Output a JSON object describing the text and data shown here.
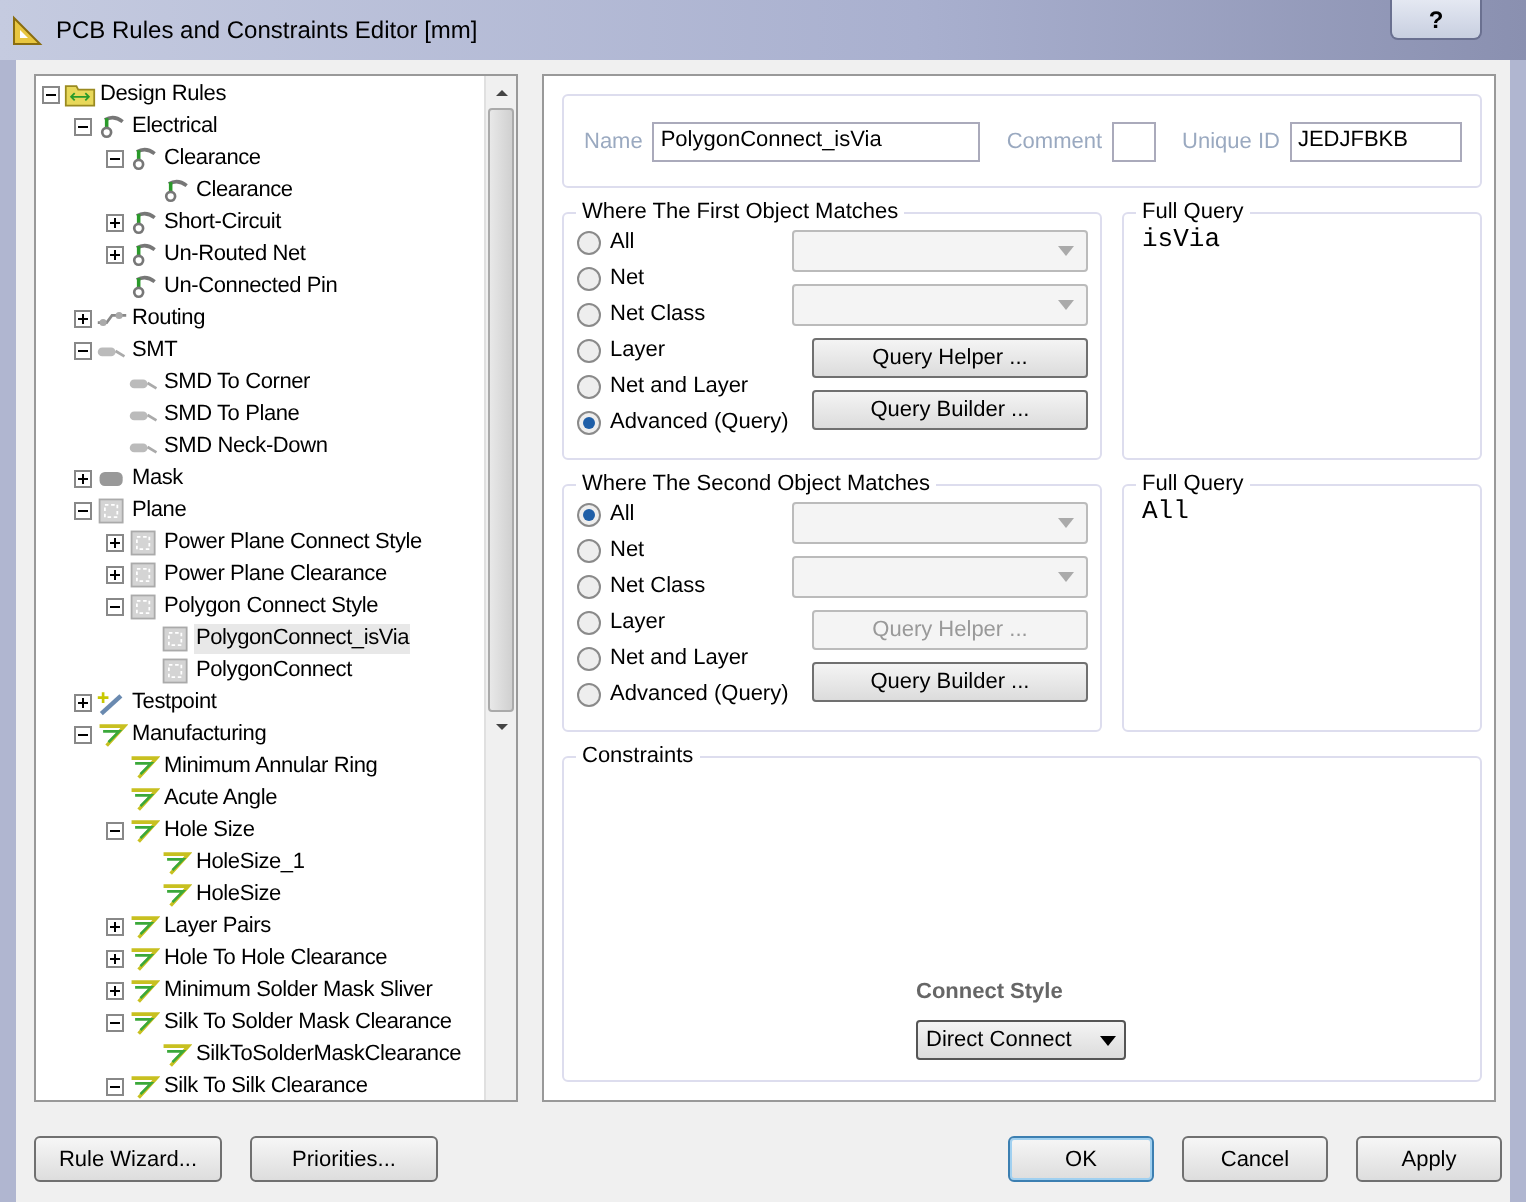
{
  "window": {
    "title": "PCB Rules and Constraints Editor [mm]",
    "help_button": "?"
  },
  "tree": [
    {
      "label": "Design Rules",
      "kind": "root",
      "expanded": true,
      "selected": false,
      "children": [
        {
          "label": "Electrical",
          "kind": "electrical",
          "expanded": true,
          "selected": false,
          "children": [
            {
              "label": "Clearance",
              "kind": "electrical",
              "expanded": true,
              "selected": false,
              "children": [
                {
                  "label": "Clearance",
                  "kind": "electrical",
                  "selected": false
                }
              ]
            },
            {
              "label": "Short-Circuit",
              "kind": "electrical",
              "expanded": false,
              "selected": false
            },
            {
              "label": "Un-Routed Net",
              "kind": "electrical",
              "expanded": false,
              "selected": false
            },
            {
              "label": "Un-Connected Pin",
              "kind": "electrical",
              "selected": false
            }
          ]
        },
        {
          "label": "Routing",
          "kind": "routing",
          "expanded": false,
          "selected": false
        },
        {
          "label": "SMT",
          "kind": "smt",
          "expanded": true,
          "selected": false,
          "children": [
            {
              "label": "SMD To Corner",
              "kind": "smt",
              "selected": false
            },
            {
              "label": "SMD To Plane",
              "kind": "smt",
              "selected": false
            },
            {
              "label": "SMD Neck-Down",
              "kind": "smt",
              "selected": false
            }
          ]
        },
        {
          "label": "Mask",
          "kind": "mask",
          "expanded": false,
          "selected": false
        },
        {
          "label": "Plane",
          "kind": "plane",
          "expanded": true,
          "selected": false,
          "children": [
            {
              "label": "Power Plane Connect Style",
              "kind": "plane",
              "expanded": false,
              "selected": false
            },
            {
              "label": "Power Plane Clearance",
              "kind": "plane",
              "expanded": false,
              "selected": false
            },
            {
              "label": "Polygon Connect Style",
              "kind": "plane",
              "expanded": true,
              "selected": false,
              "children": [
                {
                  "label": "PolygonConnect_isVia",
                  "kind": "plane",
                  "selected": true
                },
                {
                  "label": "PolygonConnect",
                  "kind": "plane",
                  "selected": false
                }
              ]
            }
          ]
        },
        {
          "label": "Testpoint",
          "kind": "testpoint",
          "expanded": false,
          "selected": false
        },
        {
          "label": "Manufacturing",
          "kind": "manufacturing",
          "expanded": true,
          "selected": false,
          "children": [
            {
              "label": "Minimum Annular Ring",
              "kind": "manufacturing",
              "selected": false
            },
            {
              "label": "Acute Angle",
              "kind": "manufacturing",
              "selected": false
            },
            {
              "label": "Hole Size",
              "kind": "manufacturing",
              "expanded": true,
              "selected": false,
              "children": [
                {
                  "label": "HoleSize_1",
                  "kind": "manufacturing",
                  "selected": false
                },
                {
                  "label": "HoleSize",
                  "kind": "manufacturing",
                  "selected": false
                }
              ]
            },
            {
              "label": "Layer Pairs",
              "kind": "manufacturing",
              "expanded": false,
              "selected": false
            },
            {
              "label": "Hole To Hole Clearance",
              "kind": "manufacturing",
              "expanded": false,
              "selected": false
            },
            {
              "label": "Minimum Solder Mask Sliver",
              "kind": "manufacturing",
              "expanded": false,
              "selected": false
            },
            {
              "label": "Silk To Solder Mask Clearance",
              "kind": "manufacturing",
              "expanded": true,
              "selected": false,
              "children": [
                {
                  "label": "SilkToSolderMaskClearance",
                  "kind": "manufacturing",
                  "selected": false
                }
              ]
            },
            {
              "label": "Silk To Silk Clearance",
              "kind": "manufacturing",
              "expanded": true,
              "selected": false
            }
          ]
        }
      ]
    }
  ],
  "rule": {
    "name_label": "Name",
    "name": "PolygonConnect_isVia",
    "comment_label": "Comment",
    "unique_id_label": "Unique ID",
    "unique_id": "JEDJFBKB"
  },
  "matches": [
    {
      "title": "Where The First Object Matches",
      "options": [
        {
          "label": "All",
          "selected": false
        },
        {
          "label": "Net",
          "selected": false
        },
        {
          "label": "Net Class",
          "selected": false
        },
        {
          "label": "Layer",
          "selected": false
        },
        {
          "label": "Net and Layer",
          "selected": false
        },
        {
          "label": "Advanced (Query)",
          "selected": true
        }
      ],
      "selects": [
        {
          "disabled": true
        },
        {
          "disabled": true
        }
      ],
      "buttons": [
        {
          "label": "Query Helper ...",
          "disabled": false
        },
        {
          "label": "Query Builder ...",
          "disabled": false
        }
      ],
      "query_title": "Full Query",
      "query": "isVia"
    },
    {
      "title": "Where The Second Object Matches",
      "options": [
        {
          "label": "All",
          "selected": true
        },
        {
          "label": "Net",
          "selected": false
        },
        {
          "label": "Net Class",
          "selected": false
        },
        {
          "label": "Layer",
          "selected": false
        },
        {
          "label": "Net and Layer",
          "selected": false
        },
        {
          "label": "Advanced (Query)",
          "selected": false
        }
      ],
      "selects": [
        {
          "disabled": true
        },
        {
          "disabled": true
        }
      ],
      "buttons": [
        {
          "label": "Query Helper ...",
          "disabled": true
        },
        {
          "label": "Query Builder ...",
          "disabled": false
        }
      ],
      "query_title": "Full Query",
      "query": "All"
    }
  ],
  "constraints": {
    "title": "Constraints",
    "field_label": "Connect Style",
    "value": "Direct Connect"
  },
  "footer": {
    "left": [
      "Rule Wizard...",
      "Priorities..."
    ],
    "right": [
      {
        "label": "OK",
        "default": true
      },
      {
        "label": "Cancel",
        "default": false
      },
      {
        "label": "Apply",
        "default": false
      }
    ]
  }
}
